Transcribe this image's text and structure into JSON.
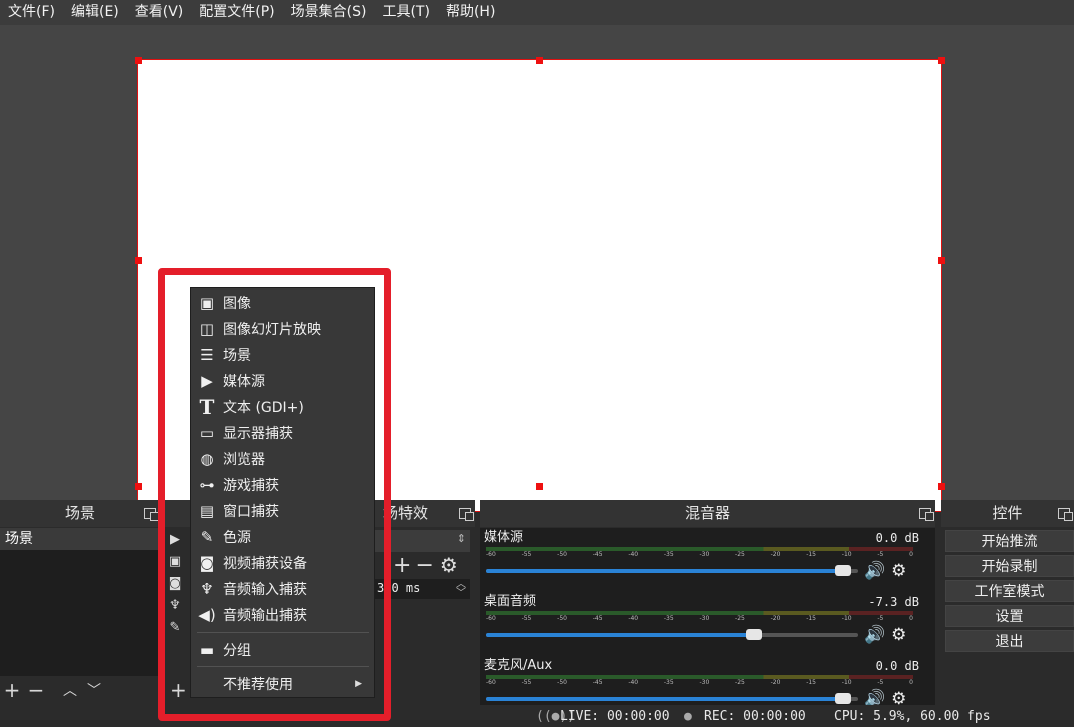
{
  "menubar": {
    "items": [
      "文件(F)",
      "编辑(E)",
      "查看(V)",
      "配置文件(P)",
      "场景集合(S)",
      "工具(T)",
      "帮助(H)"
    ]
  },
  "scenes": {
    "title": "场景",
    "items": [
      "场景"
    ]
  },
  "filters": {
    "title_partial": "场特效",
    "duration": "300 ms"
  },
  "mixer": {
    "title": "混音器",
    "channels": [
      {
        "name": "媒体源",
        "db": "0.0 dB",
        "level": 0.98
      },
      {
        "name": "桌面音频",
        "db": "-7.3 dB",
        "level": 0.73
      },
      {
        "name": "麦克风/Aux",
        "db": "0.0 dB",
        "level": 0.98
      }
    ],
    "ticks": [
      "-60",
      "-55",
      "-50",
      "-45",
      "-40",
      "-35",
      "-30",
      "-25",
      "-20",
      "-15",
      "-10",
      "-5",
      "0"
    ]
  },
  "controls": {
    "title": "控件",
    "buttons": [
      "开始推流",
      "开始录制",
      "工作室模式",
      "设置",
      "退出"
    ]
  },
  "context_menu": {
    "items": [
      {
        "label": "图像",
        "icon": "image-icon"
      },
      {
        "label": "图像幻灯片放映",
        "icon": "slideshow-icon"
      },
      {
        "label": "场景",
        "icon": "list-icon"
      },
      {
        "label": "媒体源",
        "icon": "play-icon"
      },
      {
        "label": "文本 (GDI+)",
        "icon": "text-icon"
      },
      {
        "label": "显示器捕获",
        "icon": "monitor-icon"
      },
      {
        "label": "浏览器",
        "icon": "globe-icon"
      },
      {
        "label": "游戏捕获",
        "icon": "gamepad-icon"
      },
      {
        "label": "窗口捕获",
        "icon": "window-icon"
      },
      {
        "label": "色源",
        "icon": "brush-icon"
      },
      {
        "label": "视频捕获设备",
        "icon": "camera-icon"
      },
      {
        "label": "音频输入捕获",
        "icon": "microphone-icon"
      },
      {
        "label": "音频输出捕获",
        "icon": "speaker-icon"
      }
    ],
    "group": {
      "label": "分组",
      "icon": "folder-icon"
    },
    "deprecated": {
      "label": "不推荐使用"
    }
  },
  "status": {
    "live": "LIVE: 00:00:00",
    "rec": "REC: 00:00:00",
    "cpu": "CPU: 5.9%, 60.00 fps"
  },
  "colors": {
    "highlight": "#e41e2a",
    "selection": "#e01010",
    "volume": "#2a83d6"
  }
}
